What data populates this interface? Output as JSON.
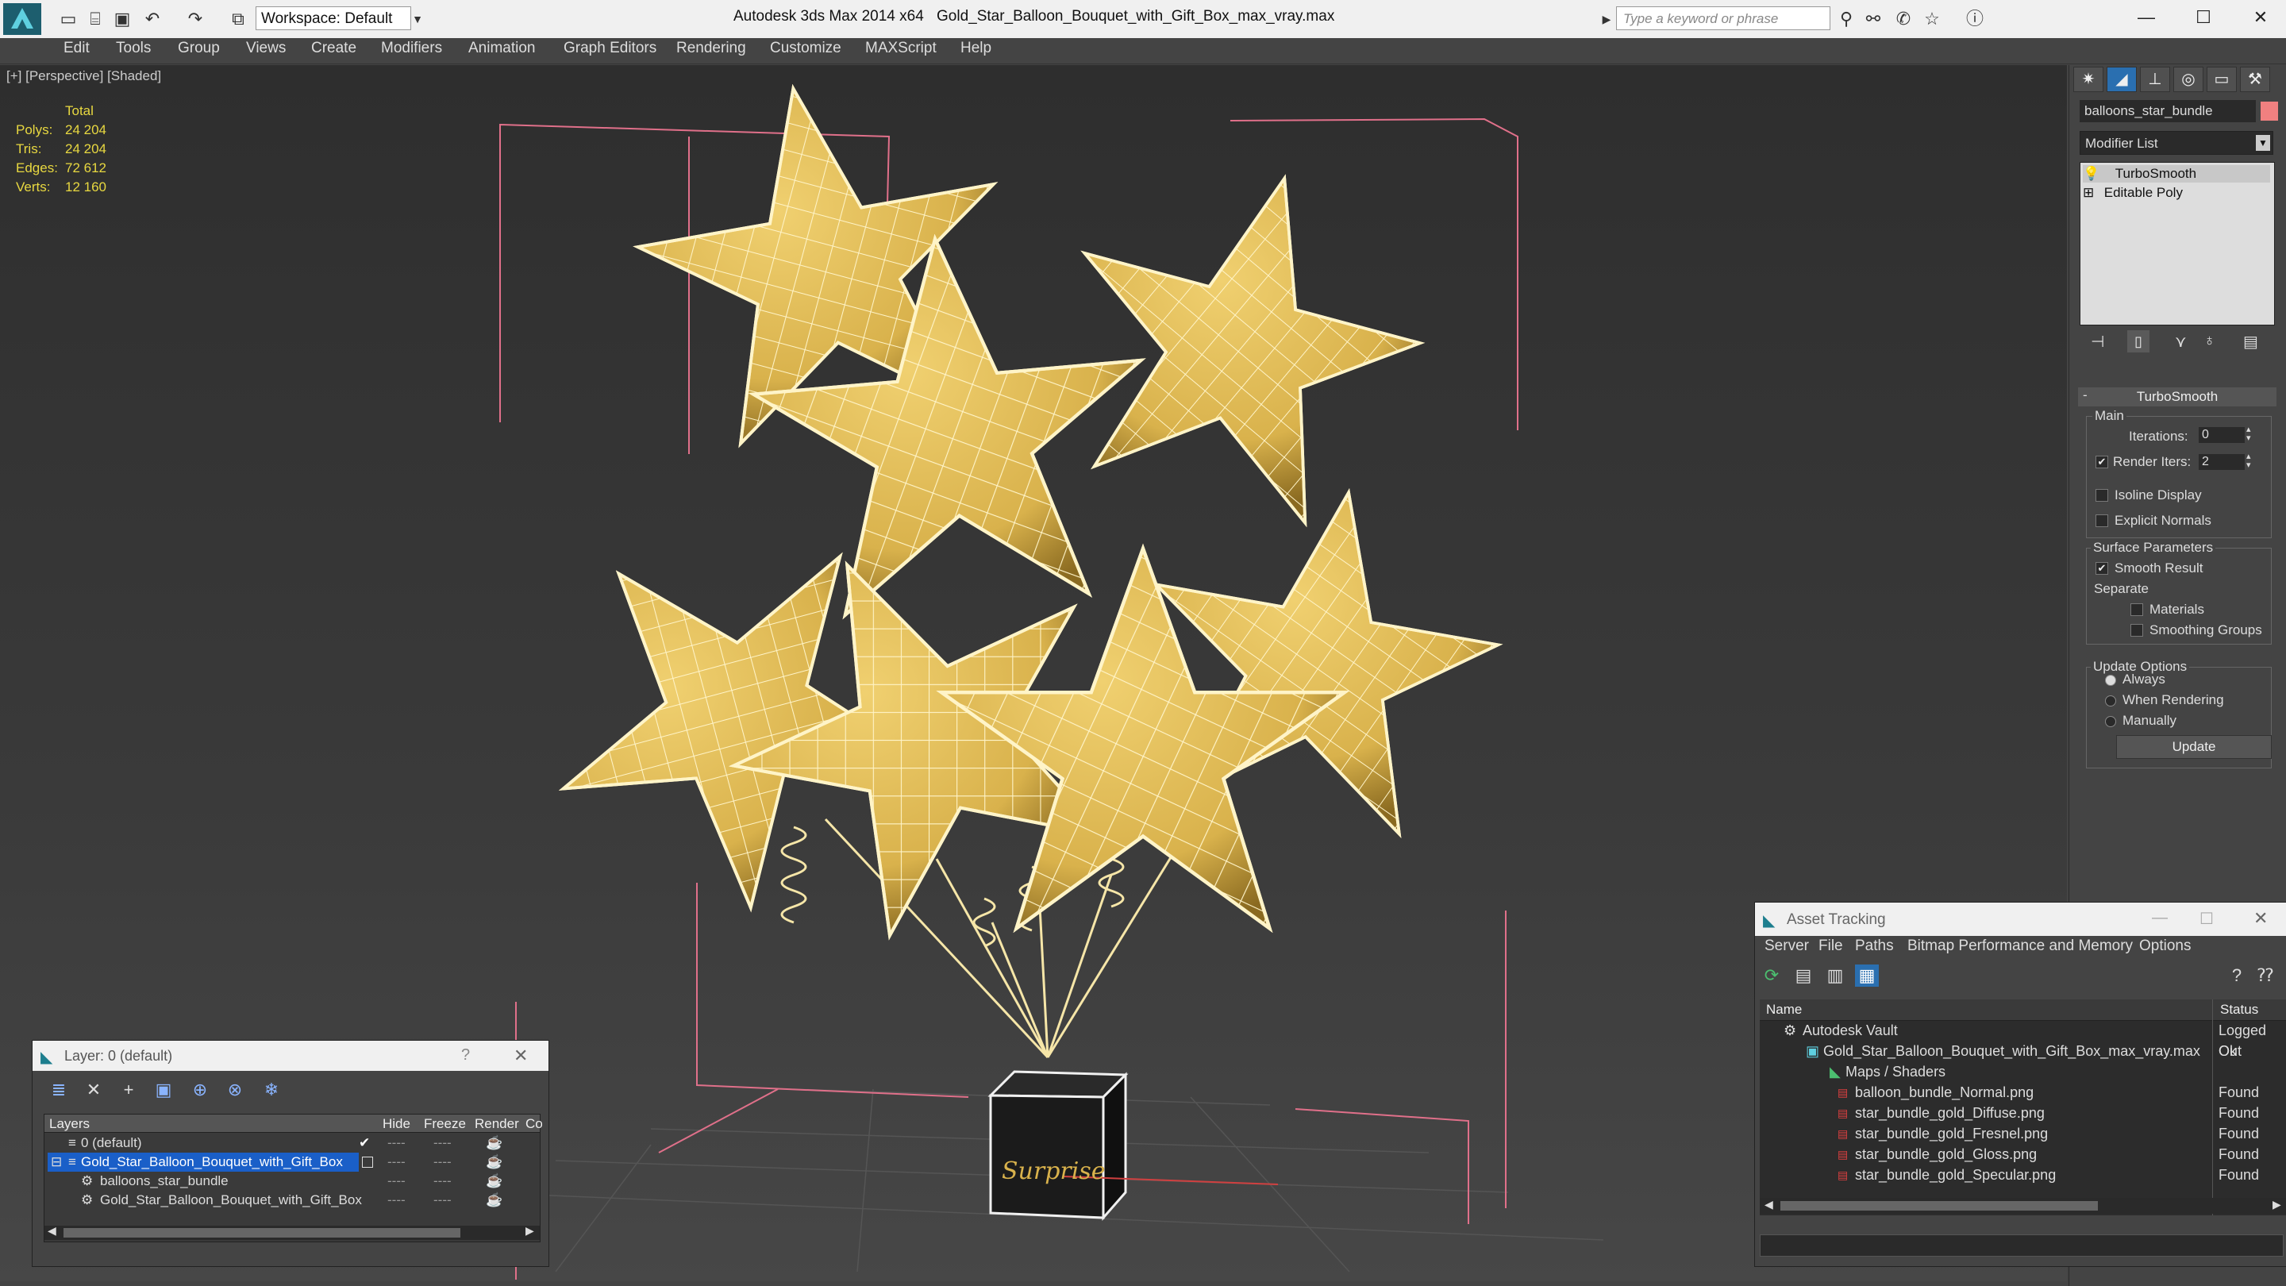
{
  "app": {
    "title": "Autodesk 3ds Max  2014 x64",
    "file": "Gold_Star_Balloon_Bouquet_with_Gift_Box_max_vray.max",
    "workspace": "Workspace: Default",
    "search_placeholder": "Type a keyword or phrase"
  },
  "menu": [
    "Edit",
    "Tools",
    "Group",
    "Views",
    "Create",
    "Modifiers",
    "Animation",
    "Graph Editors",
    "Rendering",
    "Customize",
    "MAXScript",
    "Help"
  ],
  "viewport": {
    "label": "[+] [Perspective] [Shaded]",
    "stats": {
      "header": "Total",
      "rows": [
        {
          "label": "Polys:",
          "value": "24 204"
        },
        {
          "label": "Tris:",
          "value": "24 204"
        },
        {
          "label": "Edges:",
          "value": "72 612"
        },
        {
          "label": "Verts:",
          "value": "12 160"
        }
      ]
    },
    "gift_box_text": "Surprise"
  },
  "command_panel": {
    "object_name": "balloons_star_bundle",
    "object_color": "#f08080",
    "modifier_list": "Modifier List",
    "stack": [
      "TurboSmooth",
      "Editable Poly"
    ],
    "turbosmooth": {
      "title": "TurboSmooth",
      "main_label": "Main",
      "iterations_label": "Iterations:",
      "iterations_value": "0",
      "render_iters_label": "Render Iters:",
      "render_iters_value": "2",
      "isoline": "Isoline Display",
      "explicit_normals": "Explicit Normals",
      "surface_params": "Surface Parameters",
      "smooth_result": "Smooth Result",
      "separate": "Separate",
      "materials": "Materials",
      "smoothing_groups": "Smoothing Groups",
      "update_options": "Update Options",
      "always": "Always",
      "when_rendering": "When Rendering",
      "manually": "Manually",
      "update_button": "Update"
    }
  },
  "layer_dialog": {
    "title": "Layer: 0 (default)",
    "help": "?",
    "columns": [
      "Layers",
      "Hide",
      "Freeze",
      "Render",
      "Co"
    ],
    "rows": [
      {
        "name": "0 (default)"
      },
      {
        "name": "Gold_Star_Balloon_Bouquet_with_Gift_Box"
      },
      {
        "name": "balloons_star_bundle"
      },
      {
        "name": "Gold_Star_Balloon_Bouquet_with_Gift_Box"
      }
    ],
    "dash": "----"
  },
  "asset_tracking": {
    "title": "Asset Tracking",
    "menu": [
      "Server",
      "File",
      "Paths",
      "Bitmap Performance and Memory",
      "Options"
    ],
    "columns": [
      "Name",
      "Status"
    ],
    "rows": [
      {
        "name": "Autodesk Vault",
        "status": "Logged Out"
      },
      {
        "name": "Gold_Star_Balloon_Bouquet_with_Gift_Box_max_vray.max",
        "status": "Ok"
      },
      {
        "name": "Maps / Shaders",
        "status": ""
      },
      {
        "name": "balloon_bundle_Normal.png",
        "status": "Found"
      },
      {
        "name": "star_bundle_gold_Diffuse.png",
        "status": "Found"
      },
      {
        "name": "star_bundle_gold_Fresnel.png",
        "status": "Found"
      },
      {
        "name": "star_bundle_gold_Gloss.png",
        "status": "Found"
      },
      {
        "name": "star_bundle_gold_Specular.png",
        "status": "Found"
      }
    ]
  }
}
